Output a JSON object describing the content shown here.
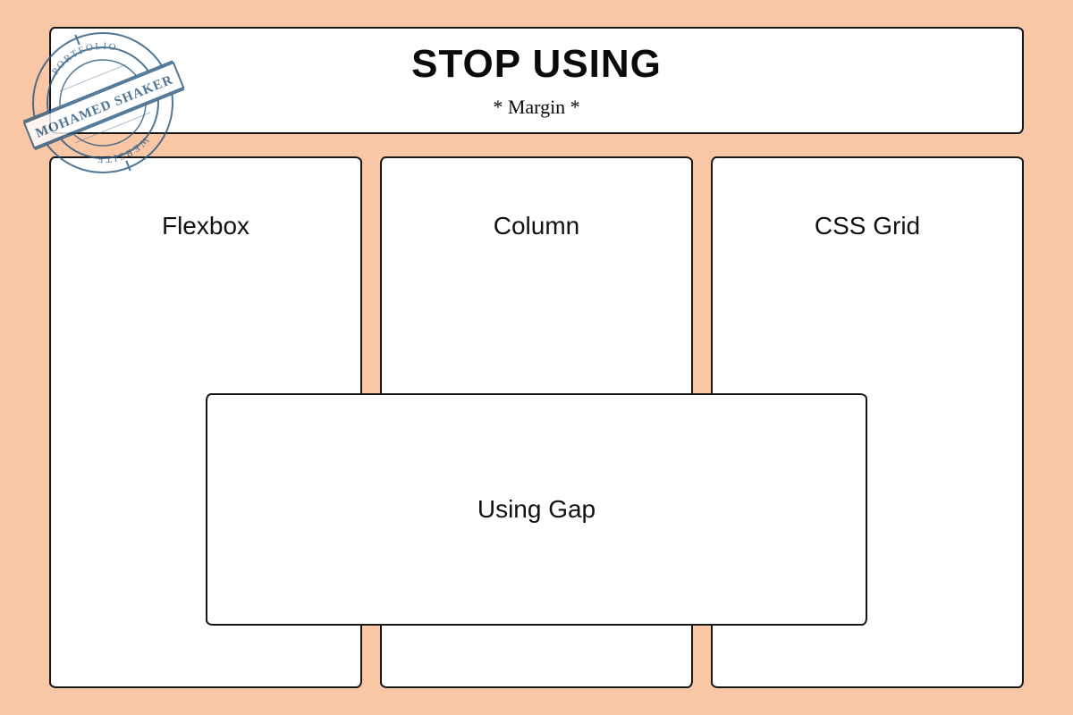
{
  "header": {
    "title": "STOP USING",
    "subtitle": "* Margin *"
  },
  "columns": {
    "c1": "Flexbox",
    "c2": "Column",
    "c3": "CSS Grid"
  },
  "overlay": {
    "label": "Using Gap"
  },
  "stamp": {
    "name_text": "MOHAMED SHAKER",
    "top_arc": "PORTFOLIO",
    "bottom_arc": "WEBSITE"
  }
}
